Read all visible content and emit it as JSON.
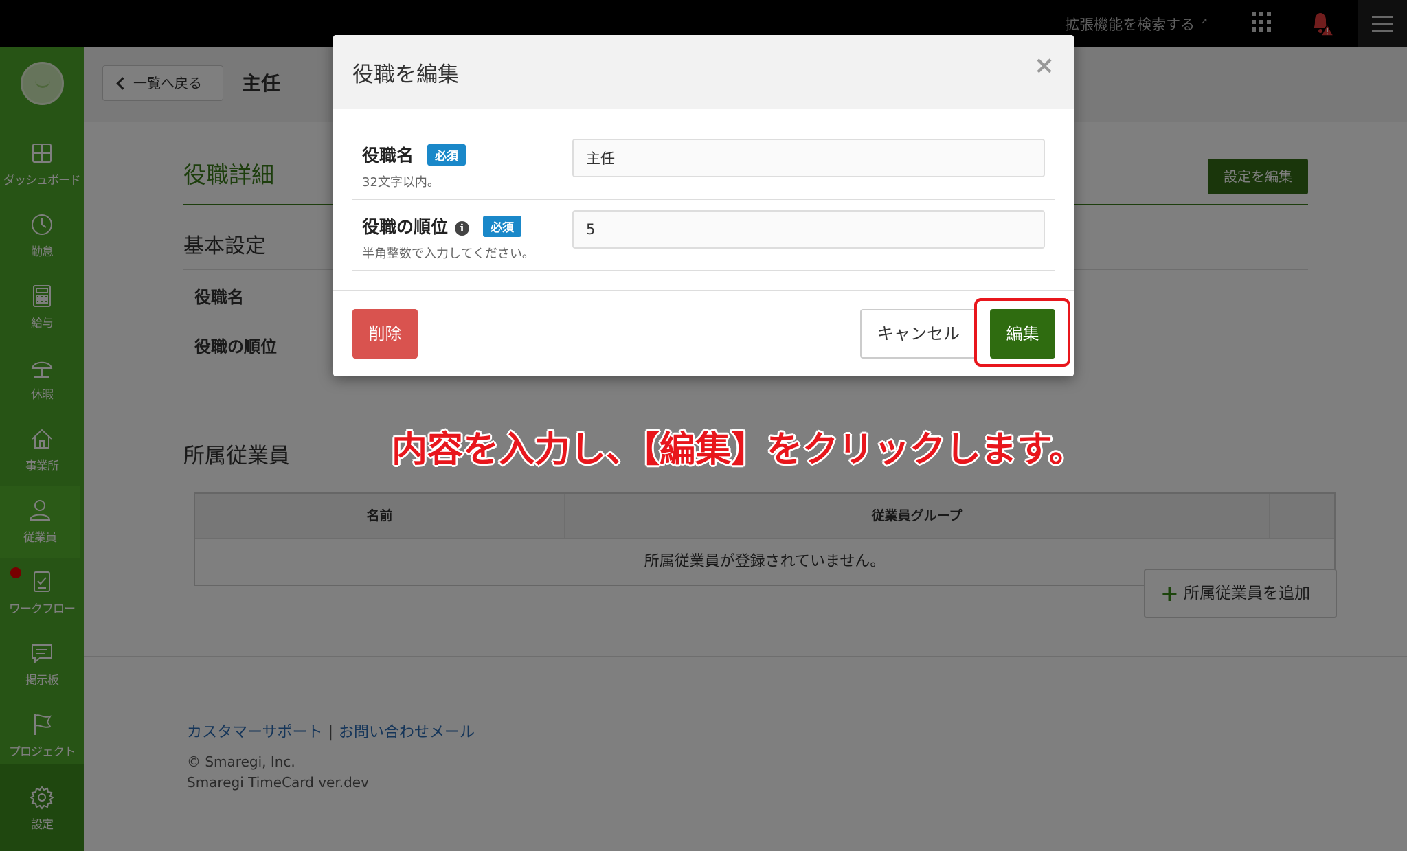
{
  "topbar": {
    "extensions_link": "拡張機能を検索する"
  },
  "sidebar": {
    "items": [
      {
        "label": "ダッシュボード",
        "icon": "dashboard-icon"
      },
      {
        "label": "勤怠",
        "icon": "clock-icon"
      },
      {
        "label": "給与",
        "icon": "calculator-icon"
      },
      {
        "label": "休暇",
        "icon": "umbrella-icon"
      },
      {
        "label": "事業所",
        "icon": "home-icon"
      },
      {
        "label": "従業員",
        "icon": "person-icon",
        "active": true
      },
      {
        "label": "ワークフロー",
        "icon": "checklist-icon"
      },
      {
        "label": "掲示板",
        "icon": "message-icon"
      },
      {
        "label": "プロジェクト",
        "icon": "flag-icon"
      },
      {
        "label": "設定",
        "icon": "gear-icon"
      }
    ]
  },
  "header": {
    "back_label": "一覧へ戻る",
    "title": "主任"
  },
  "detail": {
    "section_title": "役職詳細",
    "settings_button": "設定を編集",
    "basic_title": "基本設定",
    "rows": [
      "役職名",
      "役職の順位"
    ]
  },
  "employees": {
    "title": "所属従業員",
    "col_name": "名前",
    "col_group": "従業員グループ",
    "empty_message": "所属従業員が登録されていません。",
    "add_button": "所属従業員を追加"
  },
  "footer": {
    "support_link": "カスタマーサポート",
    "separator": "|",
    "contact_link": "お問い合わせメール",
    "copyright": "© Smaregi, Inc.",
    "version": "Smaregi TimeCard ver.dev"
  },
  "modal": {
    "title": "役職を編集",
    "close": "×",
    "fields": [
      {
        "label": "役職名",
        "badge": "必須",
        "hint": "32文字以内。",
        "value": "主任"
      },
      {
        "label": "役職の順位",
        "badge": "必須",
        "hint": "半角整数で入力してください。",
        "value": "5"
      }
    ],
    "delete_button": "削除",
    "cancel_button": "キャンセル",
    "edit_button": "編集"
  },
  "annotation": "内容を入力し、【編集】をクリックします。",
  "colors": {
    "sidebar": "#4fa92a",
    "accent_green": "#2f6c10",
    "danger": "#d9534f",
    "badge_blue": "#1a88c9",
    "annotation_red": "#e8161c"
  }
}
